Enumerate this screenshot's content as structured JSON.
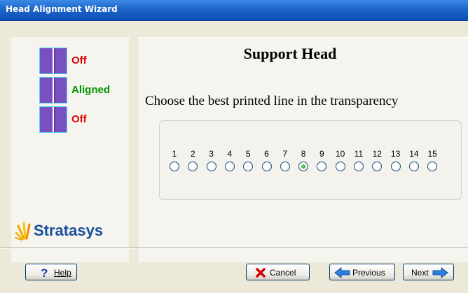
{
  "window": {
    "title": "Head Alignment Wizard"
  },
  "left_panel": {
    "status_rows": [
      {
        "label": "Off",
        "state": "off"
      },
      {
        "label": "Aligned",
        "state": "aligned"
      },
      {
        "label": "Off",
        "state": "off"
      }
    ],
    "logo_text": "Stratasys"
  },
  "main": {
    "title": "Support Head",
    "instruction": "Choose the best printed line in the transparency",
    "line_options": [
      "1",
      "2",
      "3",
      "4",
      "5",
      "6",
      "7",
      "8",
      "9",
      "10",
      "11",
      "12",
      "13",
      "14",
      "15"
    ],
    "selected_line": "8"
  },
  "buttons": {
    "help": {
      "label": "Help",
      "icon": "question-icon"
    },
    "cancel": {
      "label": "Cancel",
      "icon": "red-x-icon"
    },
    "previous": {
      "label": "Previous",
      "icon": "left-arrow-icon"
    },
    "next": {
      "label": "Next",
      "icon": "right-arrow-icon"
    }
  },
  "colors": {
    "off": "#e00000",
    "aligned": "#009400",
    "head_block": "#7a4fc0",
    "titlebar": "#1f64c8"
  }
}
